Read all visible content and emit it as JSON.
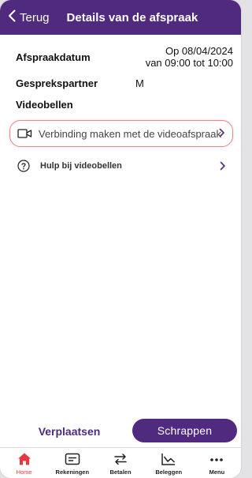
{
  "header": {
    "back_label": "Terug",
    "title": "Details van de afspraak"
  },
  "details": {
    "date_label": "Afspraakdatum",
    "date_value_line1": "Op 08/04/2024",
    "date_value_line2": "van 09:00 tot 10:00",
    "partner_label": "Gesprekspartner",
    "partner_value": "M",
    "video_heading": "Videobellen"
  },
  "links": {
    "video_connect": "Verbinding maken met de videoafspraak",
    "video_help": "Hulp bij videobellen"
  },
  "actions": {
    "move": "Verplaatsen",
    "delete": "Schrappen"
  },
  "tabbar": {
    "items": [
      {
        "label": "Home",
        "icon": "home-icon"
      },
      {
        "label": "Rekeningen",
        "icon": "card-icon"
      },
      {
        "label": "Betalen",
        "icon": "transfer-icon"
      },
      {
        "label": "Beleggen",
        "icon": "chart-icon"
      },
      {
        "label": "Menu",
        "icon": "more-icon"
      }
    ],
    "active": "Home"
  },
  "colors": {
    "brand": "#4f2a7f",
    "active_tab": "#e8383d",
    "highlight_border": "#e08a93"
  }
}
